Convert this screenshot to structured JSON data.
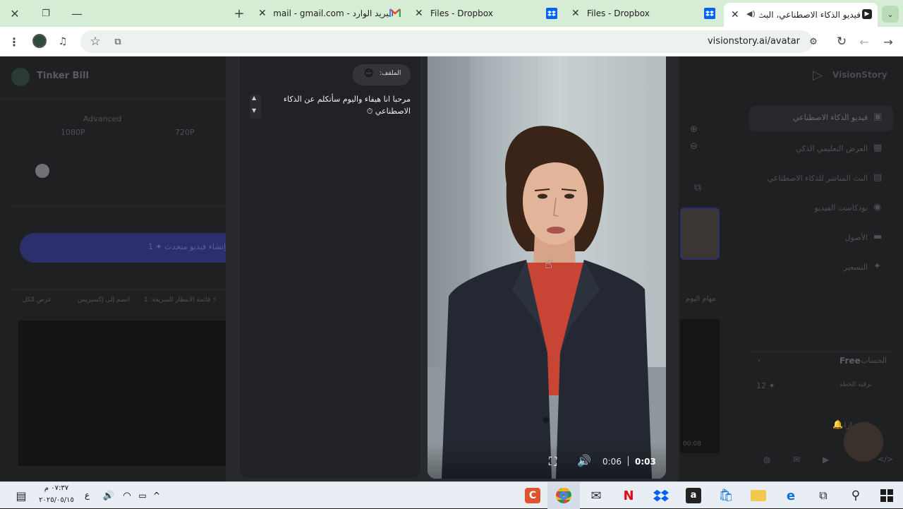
{
  "tabs": [
    {
      "title": "البريد الوارد - Gmail",
      "email": "gmail.com",
      "icon": "gmail-icon"
    },
    {
      "title": "Files - Dropbox",
      "icon": "dropbox-icon"
    },
    {
      "title": "Files - Dropbox",
      "icon": "dropbox-icon"
    },
    {
      "title": "فيديو الذكاء الاصطناعي، البث",
      "icon": "visionstory-icon"
    }
  ],
  "address": {
    "url": "visionstory.ai/avatar"
  },
  "left_panel": {
    "profile_name": "Tinker Bill",
    "res_title": "Advanced",
    "res_options": [
      "1080P",
      "720P"
    ],
    "create_button": "إنشاء فيديو متحدث ✦ 1",
    "quick_queue": "⚡ قائمة الانتظار السريعة: 1",
    "join_express": "انضم إلى إكسبريس",
    "show_all": "عرض الكل"
  },
  "chat": {
    "speaker_label": "الملقف:",
    "speaker_emoji": "😊",
    "message": "مرحبا انا هيفاء واليوم سأتكلم عن الذكاء الاصطناعي ⏱"
  },
  "video": {
    "time_current": "0:06",
    "time_total": "0:03"
  },
  "right_sidebar": {
    "brand": "VisionStory",
    "nav": [
      {
        "label": "فيديو الذكاء الاصطناعي",
        "icon": "video-plus-icon"
      },
      {
        "label": "العرض التعليمي الذكي",
        "icon": "image-icon"
      },
      {
        "label": "البث المباشر للذكاء الاصطناعي",
        "icon": "tv-icon"
      },
      {
        "label": "بودكاست الفيديو",
        "icon": "podcast-icon"
      },
      {
        "label": "الأصول",
        "icon": "folder-icon"
      },
      {
        "label": "التسعير",
        "icon": "sparkle-icon"
      }
    ],
    "today_tasks": "مهام اليوم",
    "account_label": "الحساب",
    "plan": "Free",
    "upgrade": "ترقية الخطة",
    "credits": "12 ✦",
    "notifications": "الإشعارات",
    "thumb_time": "00:08"
  },
  "taskbar": {
    "time": "٠٧:٣٧ م",
    "date": "٢٠٢٥/٠٥/١٥",
    "lang": "ع"
  }
}
